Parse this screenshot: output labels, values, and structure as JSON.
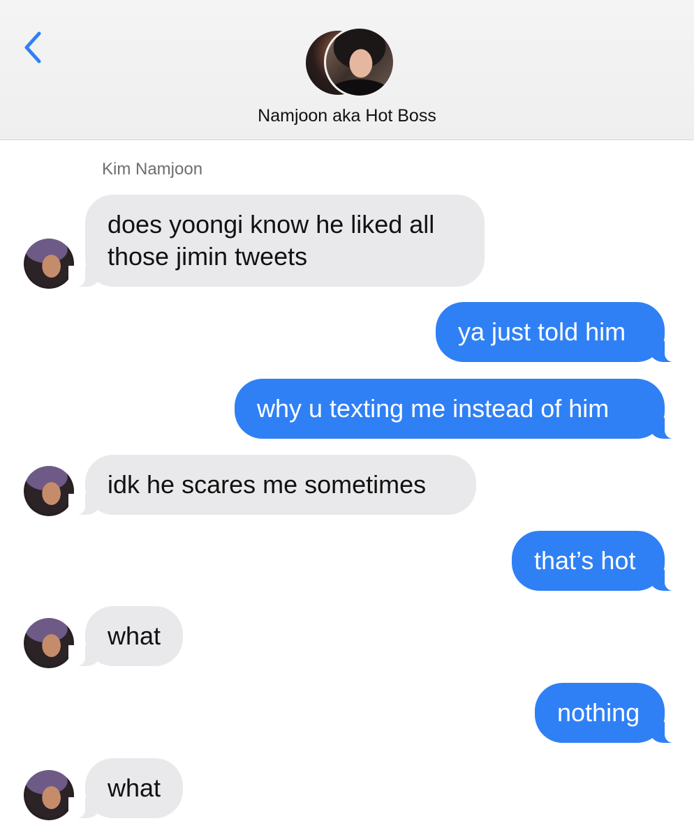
{
  "header": {
    "contact_name": "Namjoon aka Hot Boss",
    "back_icon": "chevron-left-icon",
    "accent_color": "#2f80f5"
  },
  "thread": {
    "sender_label": "Kim Namjoon",
    "messages": [
      {
        "direction": "incoming",
        "lines": [
          "does yoongi know he liked all",
          "those jimin tweets"
        ]
      },
      {
        "direction": "outgoing",
        "lines": [
          "ya just told him"
        ]
      },
      {
        "direction": "outgoing",
        "lines": [
          "why u texting me instead of him"
        ]
      },
      {
        "direction": "incoming",
        "lines": [
          "idk he scares me sometimes"
        ]
      },
      {
        "direction": "outgoing",
        "lines": [
          "that’s hot"
        ]
      },
      {
        "direction": "incoming",
        "lines": [
          "what"
        ]
      },
      {
        "direction": "outgoing",
        "lines": [
          "nothing"
        ]
      },
      {
        "direction": "incoming",
        "lines": [
          "what"
        ]
      }
    ]
  },
  "colors": {
    "incoming_bubble": "#e9e9eb",
    "outgoing_bubble": "#2f80f5"
  }
}
